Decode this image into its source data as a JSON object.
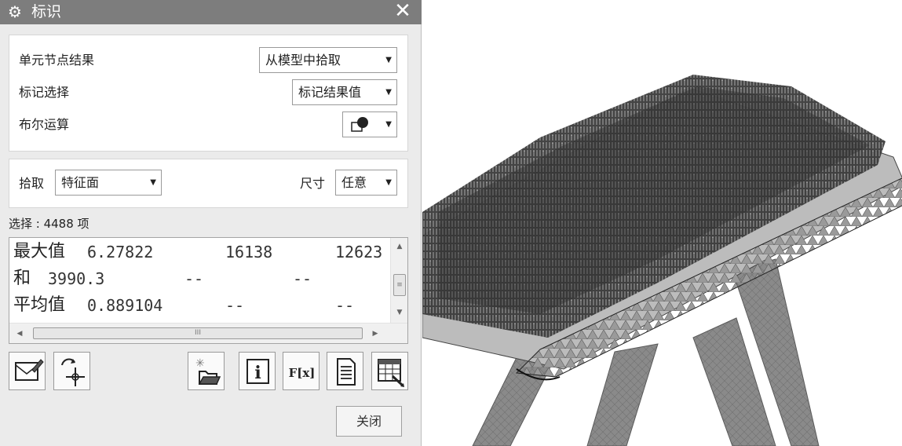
{
  "dialog": {
    "title": "标识",
    "title_icon": "gear-icon",
    "close_icon": "close-icon"
  },
  "section1": {
    "element_node_result": {
      "label": "单元节点结果",
      "value": "从模型中拾取"
    },
    "mark_selection": {
      "label": "标记选择",
      "value": "标记结果值"
    },
    "boolean_op": {
      "label": "布尔运算",
      "icon": "boolean-shapes-icon"
    }
  },
  "section2": {
    "pick": {
      "label": "拾取",
      "value": "特征面"
    },
    "size": {
      "label": "尺寸",
      "value": "任意"
    }
  },
  "selection_count": "选择 : 4488 项",
  "results": [
    {
      "name": "最大值",
      "v1": "6.27822",
      "v2": "16138",
      "v3": "12623"
    },
    {
      "name": "和",
      "v1": "3990.3",
      "v2": "--",
      "v3": "--"
    },
    {
      "name": "平均值",
      "v1": "0.889104",
      "v2": "--",
      "v3": "--"
    }
  ],
  "scrollbar_glyph": "III",
  "toolbar": [
    "edit-label-icon",
    "rotate-crosshair-icon",
    "open-folder-icon",
    "info-icon",
    "function-fx-icon",
    "document-icon",
    "table-export-icon"
  ],
  "fx_label": "F[x]",
  "info_label": "i",
  "close_button": "关闭",
  "colors": {
    "titlebar": "#7d7d7d",
    "dialog_bg": "#ebebeb",
    "panel_bg": "#ffffff"
  }
}
